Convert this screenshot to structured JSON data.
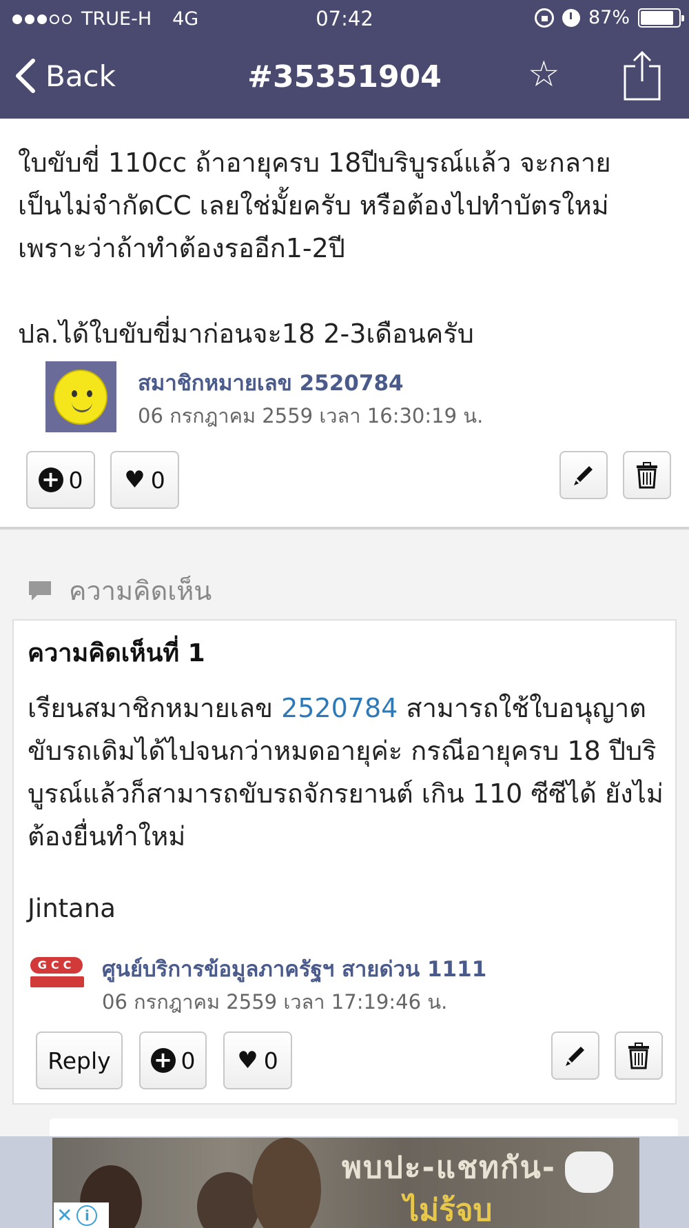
{
  "status_bar": {
    "carrier": "TRUE-H",
    "network": "4G",
    "time": "07:42",
    "battery": "87%",
    "battery_level": 0.87,
    "signal_bars": 3
  },
  "nav": {
    "back_label": "Back",
    "title": "#35351904"
  },
  "post": {
    "text": "ใบขับขี่ 110cc ถ้าอายุครบ 18ปีบริบูรณ์แล้ว จะกลาย\nเป็นไม่จำกัดCC เลยใช่มั้ยครับ หรือต้องไปทำบัตรใหม่\nเพราะว่าถ้าทำต้องรออีก1-2ปี\n\nปล.ได้ใบขับขี่มาก่อนจะ18 2-3เดือนครับ",
    "author": "สมาชิกหมายเลข 2520784",
    "date": "06 กรกฎาคม 2559 เวลา 16:30:19 น.",
    "plus_count": "0",
    "heart_count": "0"
  },
  "comments": {
    "header": "ความคิดเห็น",
    "items": [
      {
        "title": "ความคิดเห็นที่ 1",
        "text_before_link": "เรียนสมาชิกหมายเลข ",
        "link": "2520784",
        "text_after_link": " สามารถใช้ใบอนุญาตขับรถเดิมได้ไปจนกว่าหมดอายุค่ะ กรณีอายุครบ 18 ปีบริบูรณ์แล้วก็สามารถขับรถจักรยานต์ เกิน 110 ซีซีได้  ยังไม่ต้องยื่นทำใหม่",
        "signature": "Jintana",
        "logo_text": "GCC",
        "author": "ศูนย์บริการข้อมูลภาครัฐฯ สายด่วน 1111",
        "date": "06 กรกฎาคม 2559 เวลา 17:19:46 น.",
        "reply_label": "Reply",
        "plus_count": "0",
        "heart_count": "0"
      }
    ]
  },
  "ad": {
    "line1": "พบปะ-แชทกัน-",
    "line2": "ไม่ร้จบ"
  },
  "colors": {
    "header_bg": "#4a4a70",
    "author_link": "#4a5a8a",
    "comment_link": "#2e7ab8"
  },
  "icons": [
    "chevron-left-icon",
    "star-icon",
    "share-icon",
    "plus-circle-icon",
    "heart-icon",
    "pencil-icon",
    "trash-icon",
    "speech-bubble-icon",
    "ad-choices-icon"
  ]
}
